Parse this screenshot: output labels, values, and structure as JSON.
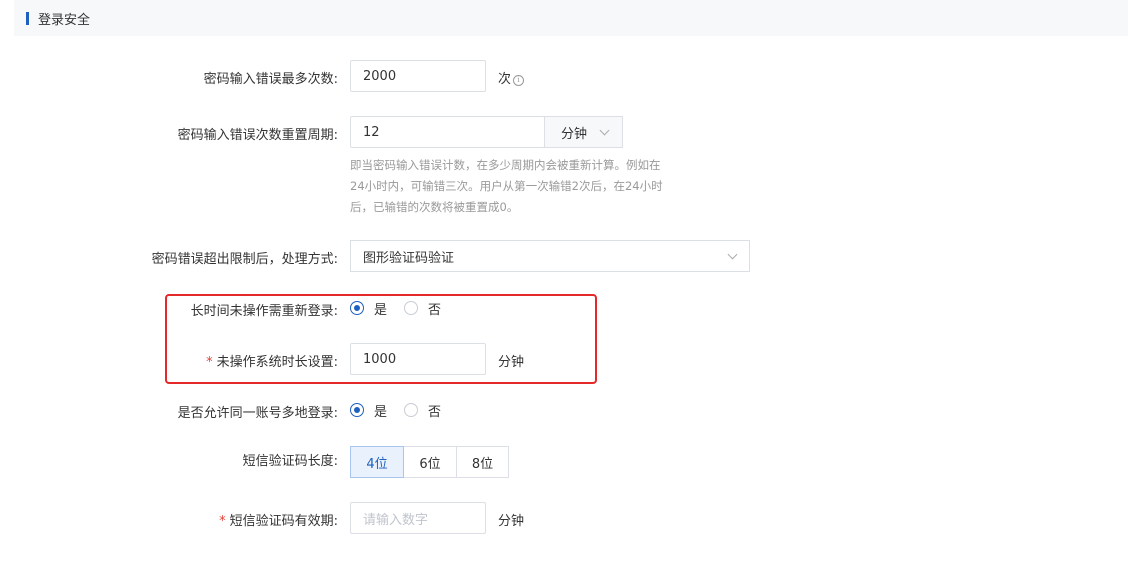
{
  "section": {
    "title": "登录安全"
  },
  "max_attempts": {
    "label": "密码输入错误最多次数:",
    "value": "2000",
    "unit": "次",
    "info_icon": "info-icon"
  },
  "reset_period": {
    "label": "密码输入错误次数重置周期:",
    "value": "12",
    "unit_selected": "分钟",
    "hint_lines": [
      "即当密码输入错误计数，在多少周期内会被重新计算。例如在",
      "24小时内，可输错三次。用户从第一次输错2次后，在24小时",
      "后，已输错的次数将被重置成0。"
    ]
  },
  "exceed_handling": {
    "label": "密码错误超出限制后，处理方式:",
    "selected": "图形验证码验证"
  },
  "idle_relogin": {
    "label": "长时间未操作需重新登录:",
    "options": [
      "是",
      "否"
    ],
    "selected": "是"
  },
  "idle_duration": {
    "label": "未操作系统时长设置:",
    "required": "*",
    "value": "1000",
    "unit": "分钟"
  },
  "multi_login": {
    "label": "是否允许同一账号多地登录:",
    "options": [
      "是",
      "否"
    ],
    "selected": "是"
  },
  "sms_length": {
    "label": "短信验证码长度:",
    "options": [
      "4位",
      "6位",
      "8位"
    ],
    "selected": "4位"
  },
  "sms_validity": {
    "label": "短信验证码有效期:",
    "required": "*",
    "placeholder": "请输入数字",
    "unit": "分钟"
  },
  "colors": {
    "primary": "#1e5fc0",
    "highlight": "#e5292a",
    "required": "#e33e33"
  }
}
